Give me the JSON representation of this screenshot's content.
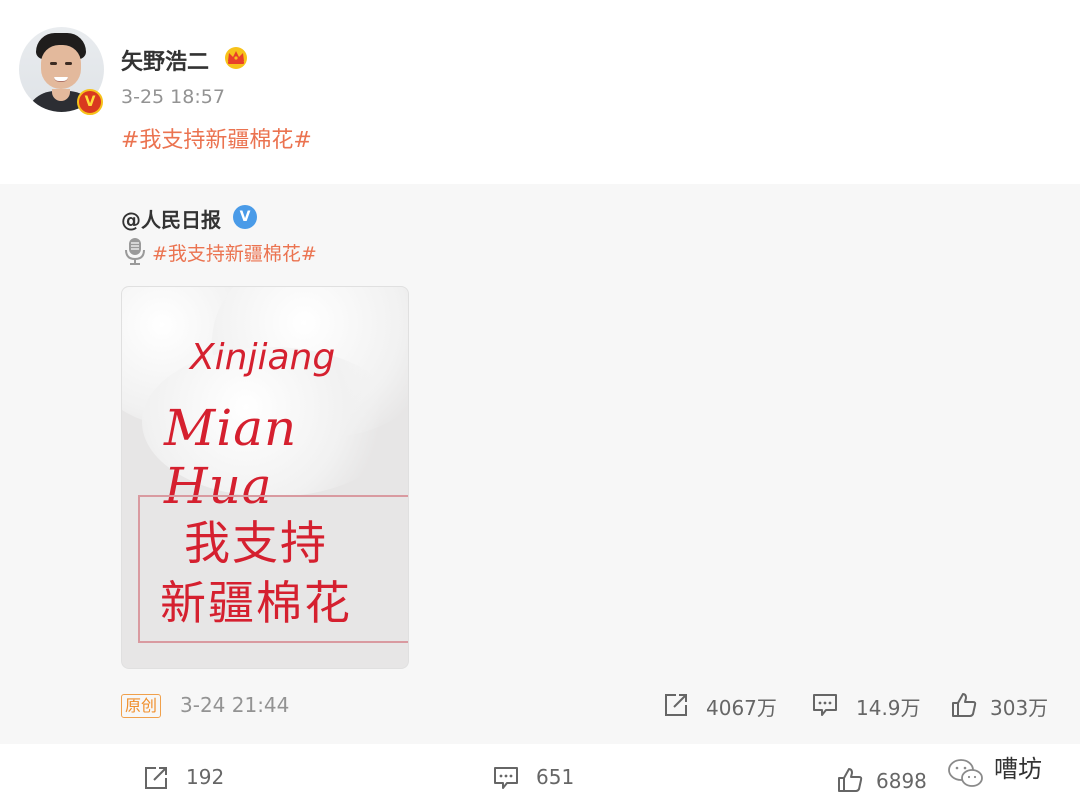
{
  "post": {
    "username": "矢野浩二",
    "timestamp": "3-25 18:57",
    "hashtag": "#我支持新疆棉花#"
  },
  "repost": {
    "user": "@人民日报",
    "hashtag": "#我支持新疆棉花#",
    "image": {
      "line1": "Xinjiang",
      "line2": "Mian Hua",
      "zh_line1": "我支持",
      "zh_line2": "新疆棉花"
    },
    "original_badge": "原创",
    "time": "3-24 21:44",
    "stats": {
      "reposts": "4067万",
      "comments": "14.9万",
      "likes": "303万"
    }
  },
  "bottom_bar": {
    "reposts": "192",
    "comments": "651",
    "likes": "6898",
    "watermark": "嘈坊"
  },
  "colors": {
    "accent_orange": "#eb7350",
    "verified_blue": "#4a9be8",
    "badge_red": "#d9391f",
    "image_red": "#d5202f"
  },
  "icons": [
    "crown-icon",
    "verified-v-icon",
    "microphone-icon",
    "repost-icon",
    "comment-icon",
    "like-icon",
    "wechat-icon"
  ]
}
